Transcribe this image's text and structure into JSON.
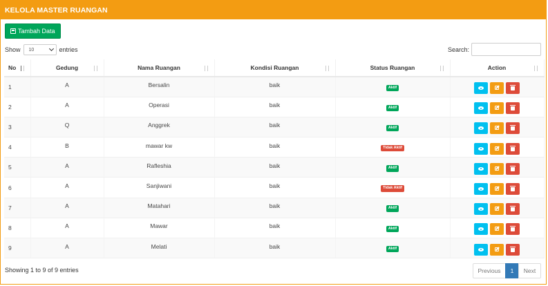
{
  "header": {
    "title": "KELOLA MASTER RUANGAN"
  },
  "toolbar": {
    "add_label": "Tambah Data"
  },
  "length": {
    "show_label": "Show",
    "value": "10",
    "entries_label": "entries"
  },
  "search": {
    "label": "Search:",
    "value": ""
  },
  "table": {
    "columns": [
      "No",
      "Gedung",
      "Nama Ruangan",
      "Kondisi Ruangan",
      "Status Ruangan",
      "Action"
    ],
    "rows": [
      {
        "no": "1",
        "gedung": "A",
        "nama": "Bersalin",
        "kondisi": "baik",
        "status": "Aktif",
        "active": true
      },
      {
        "no": "2",
        "gedung": "A",
        "nama": "Operasi",
        "kondisi": "baik",
        "status": "Aktif",
        "active": true
      },
      {
        "no": "3",
        "gedung": "Q",
        "nama": "Anggrek",
        "kondisi": "baik",
        "status": "Aktif",
        "active": true
      },
      {
        "no": "4",
        "gedung": "B",
        "nama": "mawar kw",
        "kondisi": "baik",
        "status": "Tidak Aktif",
        "active": false
      },
      {
        "no": "5",
        "gedung": "A",
        "nama": "Rafleshia",
        "kondisi": "baik",
        "status": "Aktif",
        "active": true
      },
      {
        "no": "6",
        "gedung": "A",
        "nama": "Sanjiwani",
        "kondisi": "baik",
        "status": "Tidak Aktif",
        "active": false
      },
      {
        "no": "7",
        "gedung": "A",
        "nama": "Matahari",
        "kondisi": "baik",
        "status": "Aktif",
        "active": true
      },
      {
        "no": "8",
        "gedung": "A",
        "nama": "Mawar",
        "kondisi": "baik",
        "status": "Aktif",
        "active": true
      },
      {
        "no": "9",
        "gedung": "A",
        "nama": "Melati",
        "kondisi": "baik",
        "status": "Aktif",
        "active": true
      }
    ]
  },
  "footer": {
    "info": "Showing 1 to 9 of 9 entries"
  },
  "pagination": {
    "previous": "Previous",
    "current": "1",
    "next": "Next"
  },
  "icons": {
    "add": "save-icon",
    "view": "eye-icon",
    "edit": "edit-icon",
    "delete": "trash-icon",
    "sort": "sort-icon"
  },
  "colors": {
    "header": "#f39c12",
    "add": "#00a65a",
    "active": "#00a65a",
    "inactive": "#dd4b39",
    "view": "#00c0ef",
    "edit": "#f39c12",
    "delete": "#dd4b39",
    "page": "#337ab7"
  }
}
